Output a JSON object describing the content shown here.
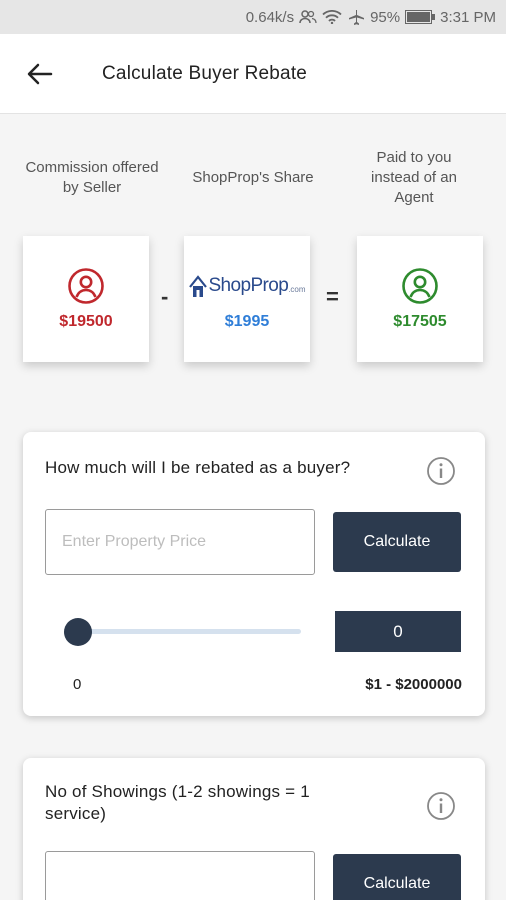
{
  "status_bar": {
    "speed": "0.64k/s",
    "battery": "95%",
    "time": "3:31 PM"
  },
  "header": {
    "title": "Calculate Buyer Rebate"
  },
  "summary": {
    "commission_label": "Commission offered by Seller",
    "share_label": "ShopProp's Share",
    "paid_label": "Paid to you instead of an Agent",
    "commission_amount": "$19500",
    "share_amount": "$1995",
    "paid_amount": "$17505",
    "minus_op": "-",
    "equals_op": "=",
    "logo_text": "ShopProp",
    "logo_suffix": ".com",
    "colors": {
      "commission": "#c0282d",
      "share": "#2f7ed8",
      "paid": "#2e8b2e"
    }
  },
  "rebate": {
    "question": "How much will I be rebated as a buyer?",
    "input_placeholder": "Enter Property Price",
    "button_label": "Calculate",
    "slider_value": "0",
    "range_min": "0",
    "range_max": "$1 - $2000000"
  },
  "showings": {
    "question": "No of Showings (1-2 showings = 1 service)",
    "button_label": "Calculate"
  }
}
